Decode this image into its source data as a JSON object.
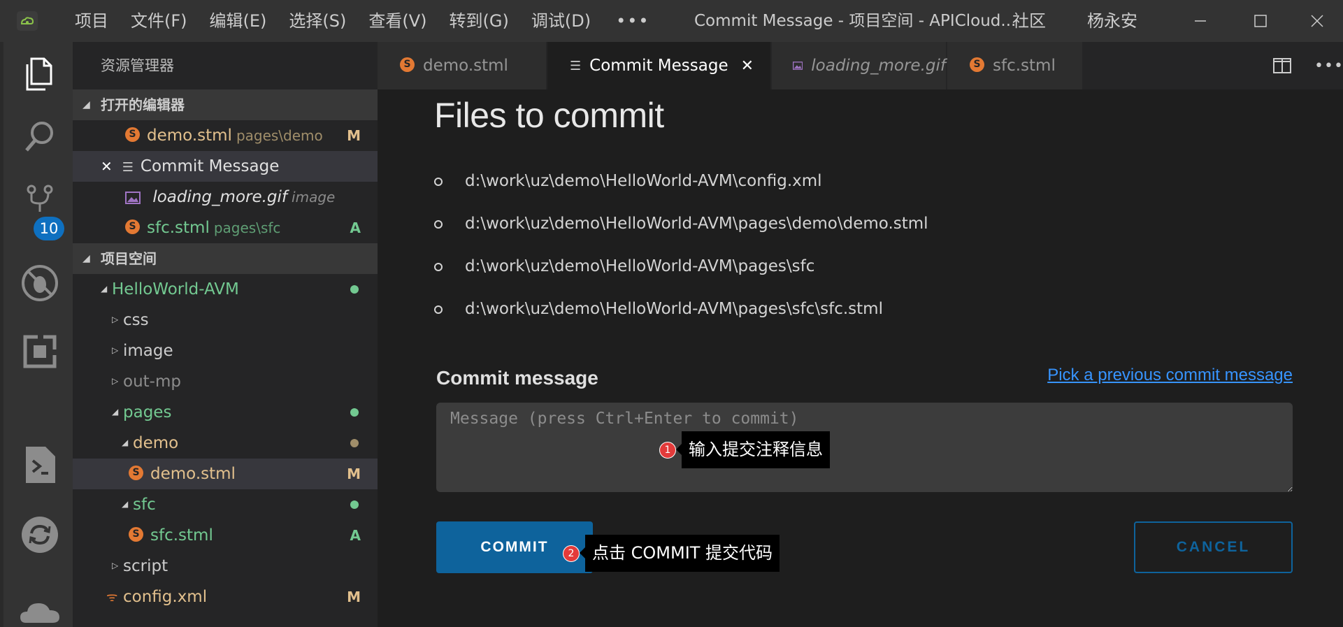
{
  "titlebar": {
    "menu": [
      "项目",
      "文件(F)",
      "编辑(E)",
      "选择(S)",
      "查看(V)",
      "转到(G)",
      "调试(D)"
    ],
    "more": "•••",
    "window_title": "Commit Message - 项目空间 - APICloud...",
    "community": "社区",
    "user": "杨永安"
  },
  "activitybar": {
    "icons": [
      "explorer-icon",
      "search-icon",
      "source-control-icon",
      "debug-icon",
      "extensions-icon",
      "terminal-icon",
      "sync-icon",
      "cloud-icon"
    ],
    "scm_badge": "10"
  },
  "sidebar": {
    "title": "资源管理器",
    "open_editors_header": "打开的编辑器",
    "open_editors": [
      {
        "name": "demo.stml",
        "desc": "pages\\demo",
        "status": "M"
      },
      {
        "name": "Commit Message",
        "close": "✕"
      },
      {
        "name": "loading_more.gif",
        "desc": "image"
      },
      {
        "name": "sfc.stml",
        "desc": "pages\\sfc",
        "status": "A"
      }
    ],
    "workspace_header": "项目空间",
    "tree": {
      "root": "HelloWorld-AVM",
      "css": "css",
      "image": "image",
      "out_mp": "out-mp",
      "pages": "pages",
      "demo_folder": "demo",
      "demo_file": "demo.stml",
      "demo_file_status": "M",
      "sfc_folder": "sfc",
      "sfc_file": "sfc.stml",
      "sfc_file_status": "A",
      "script": "script",
      "config": "config.xml",
      "config_status": "M"
    }
  },
  "tabs": [
    {
      "label": "demo.stml",
      "icon": "S"
    },
    {
      "label": "Commit Message",
      "close": "✕"
    },
    {
      "label": "loading_more.gif"
    },
    {
      "label": "sfc.stml",
      "icon": "S"
    }
  ],
  "editor": {
    "files_heading": "Files to commit",
    "files": [
      "d:\\work\\uz\\demo\\HelloWorld-AVM\\config.xml",
      "d:\\work\\uz\\demo\\HelloWorld-AVM\\pages\\demo\\demo.stml",
      "d:\\work\\uz\\demo\\HelloWorld-AVM\\pages\\sfc",
      "d:\\work\\uz\\demo\\HelloWorld-AVM\\pages\\sfc\\sfc.stml"
    ],
    "commit_label": "Commit message",
    "prev_link": "Pick a previous commit message",
    "input_placeholder": "Message (press Ctrl+Enter to commit)",
    "commit_button": "COMMIT",
    "cancel_button": "CANCEL"
  },
  "callouts": [
    {
      "num": "1",
      "text": "输入提交注释信息"
    },
    {
      "num": "2",
      "text": "点击 COMMIT 提交代码"
    }
  ],
  "colors": {
    "accent": "#0e639c",
    "badge": "#0e70c0",
    "modified": "#e2c08d",
    "added": "#73c991",
    "callout_num": "#e33a3a"
  }
}
